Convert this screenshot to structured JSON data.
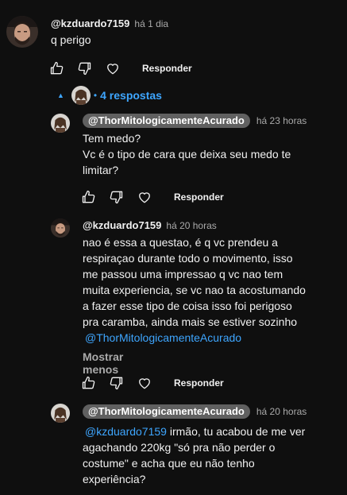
{
  "top_comment": {
    "author": "@kzduardo7159",
    "time": "há 1 dia",
    "text": "q perigo",
    "reply_label": "Responder"
  },
  "replies_toggle": {
    "label": "4 respostas"
  },
  "replies": [
    {
      "author": "@ThorMitologicamenteAcurado",
      "time": "há 23 horas",
      "lines": [
        "Tem medo?",
        "Vc é o tipo de cara que deixa seu medo te",
        "limitar?"
      ],
      "reply_label": "Responder"
    },
    {
      "author": "@kzduardo7159",
      "time": "há 20 horas",
      "lines": [
        "nao é essa a questao, é q vc prendeu a",
        "respiraçao durante todo o movimento, isso",
        "me passou uma impressao q vc nao tem",
        "muita experiencia, se vc nao ta acostumando",
        "a fazer esse tipo de coisa isso foi perigoso",
        "pra caramba, ainda mais se estiver sozinho"
      ],
      "mention": "@ThorMitologicamenteAcurado",
      "show_less": "Mostrar menos",
      "reply_label": "Responder"
    },
    {
      "author": "@ThorMitologicamenteAcurado",
      "time": "há 20 horas",
      "mention": "@kzduardo7159",
      "first_line_rest": "irmão, tu acabou de me ver",
      "lines": [
        "agachando 220kg \"só pra não perder o",
        "costume\" e acha que eu não tenho",
        "experiência?"
      ]
    }
  ],
  "icons": {
    "like": "thumbs-up-icon",
    "dislike": "thumbs-down-icon",
    "heart": "heart-icon",
    "caret": "caret-up-icon"
  },
  "colors": {
    "background": "#0f0f0f",
    "link": "#3ea6ff",
    "chip": "#606060",
    "muted": "#aaaaaa"
  }
}
